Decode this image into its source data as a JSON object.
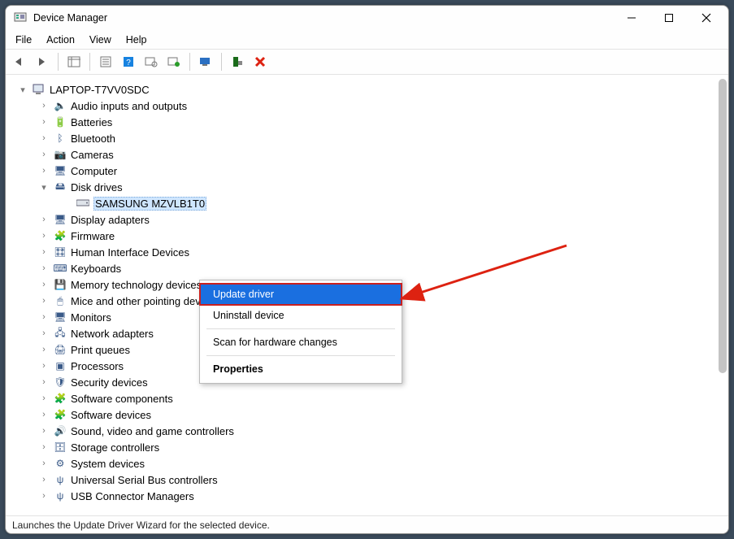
{
  "window": {
    "title": "Device Manager"
  },
  "menu": {
    "file": "File",
    "action": "Action",
    "view": "View",
    "help": "Help"
  },
  "toolbar": {
    "back": "back-icon",
    "forward": "forward-icon",
    "show_hide": "show-hide-tree-icon",
    "properties": "properties-icon",
    "help": "help-icon",
    "scan": "scan-icon",
    "enable": "enable-icon",
    "monitor": "monitor-icon",
    "device": "device-icon",
    "delete": "delete-icon"
  },
  "root": {
    "label": "LAPTOP-T7VV0SDC"
  },
  "categories": [
    {
      "id": "audio",
      "label": "Audio inputs and outputs",
      "expanded": false
    },
    {
      "id": "batt",
      "label": "Batteries",
      "expanded": false
    },
    {
      "id": "bt",
      "label": "Bluetooth",
      "expanded": false
    },
    {
      "id": "cam",
      "label": "Cameras",
      "expanded": false
    },
    {
      "id": "pc",
      "label": "Computer",
      "expanded": false
    },
    {
      "id": "disk",
      "label": "Disk drives",
      "expanded": true,
      "children": [
        {
          "id": "samsung",
          "label": "SAMSUNG MZVLB1T0"
        }
      ]
    },
    {
      "id": "disp",
      "label": "Display adapters",
      "expanded": false
    },
    {
      "id": "fw",
      "label": "Firmware",
      "expanded": false
    },
    {
      "id": "hid",
      "label": "Human Interface Devices",
      "expanded": false
    },
    {
      "id": "kb",
      "label": "Keyboards",
      "expanded": false
    },
    {
      "id": "mem",
      "label": "Memory technology devices",
      "expanded": false
    },
    {
      "id": "mouse",
      "label": "Mice and other pointing devices",
      "expanded": false
    },
    {
      "id": "mon",
      "label": "Monitors",
      "expanded": false
    },
    {
      "id": "net",
      "label": "Network adapters",
      "expanded": false
    },
    {
      "id": "print",
      "label": "Print queues",
      "expanded": false
    },
    {
      "id": "cpu",
      "label": "Processors",
      "expanded": false
    },
    {
      "id": "sec",
      "label": "Security devices",
      "expanded": false
    },
    {
      "id": "softc",
      "label": "Software components",
      "expanded": false
    },
    {
      "id": "softd",
      "label": "Software devices",
      "expanded": false
    },
    {
      "id": "sound",
      "label": "Sound, video and game controllers",
      "expanded": false
    },
    {
      "id": "stor",
      "label": "Storage controllers",
      "expanded": false
    },
    {
      "id": "sys",
      "label": "System devices",
      "expanded": false
    },
    {
      "id": "usb",
      "label": "Universal Serial Bus controllers",
      "expanded": false
    },
    {
      "id": "usbcon",
      "label": "USB Connector Managers",
      "expanded": false
    }
  ],
  "context_menu": {
    "update": "Update driver",
    "uninstall": "Uninstall device",
    "scan": "Scan for hardware changes",
    "properties": "Properties"
  },
  "status": {
    "text": "Launches the Update Driver Wizard for the selected device."
  },
  "icons": {
    "audio": "🔈",
    "batt": "🔋",
    "bt": "ᛒ",
    "cam": "📷",
    "pc": "🖥",
    "disk": "🖴",
    "child": "▭",
    "disp": "🖥",
    "fw": "🧩",
    "hid": "🎛",
    "kb": "⌨",
    "mem": "💾",
    "mouse": "🖱",
    "mon": "🖥",
    "net": "🖧",
    "print": "🖨",
    "cpu": "▣",
    "sec": "🛡",
    "softc": "🧩",
    "softd": "🧩",
    "sound": "🔊",
    "stor": "🗄",
    "sys": "⚙",
    "usb": "ψ",
    "usbcon": "ψ"
  }
}
